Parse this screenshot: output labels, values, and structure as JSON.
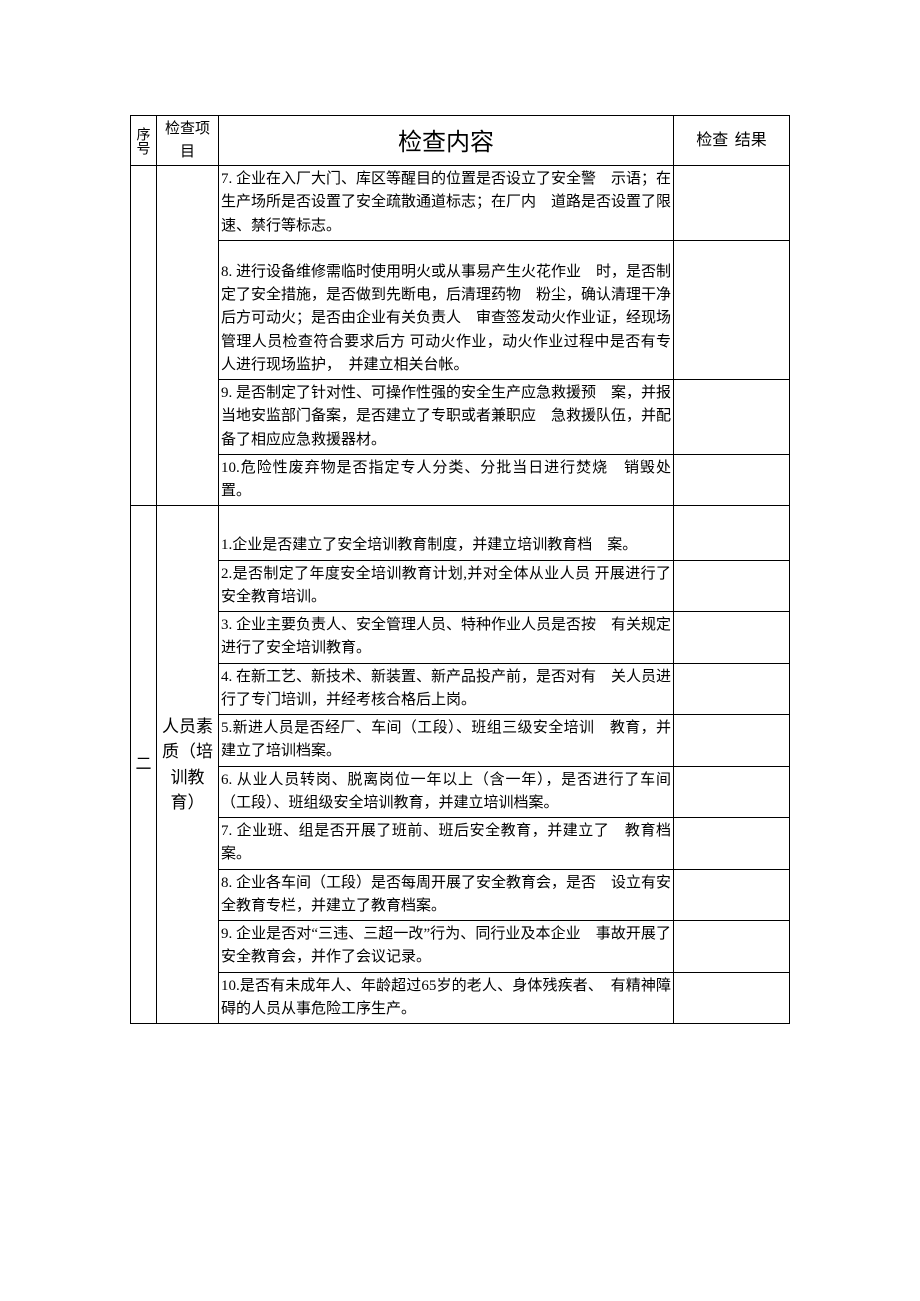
{
  "headers": {
    "seq": "序号",
    "item": "检查项目",
    "content": "检查内容",
    "result": "检查 结果"
  },
  "section1": {
    "rows": [
      "7. 企业在入厂大门、库区等醒目的位置是否设立了安全警　示语；在生产场所是否设置了安全疏散通道标志；在厂内　道路是否设置了限速、禁行等标志。",
      "8. 进行设备维修需临时使用明火或从事易产生火花作业　时，是否制定了安全措施，是否做到先断电，后清理药物　粉尘，确认清理干净后方可动火；是否由企业有关负责人　审查签发动火作业证，经现场管理人员检查符合要求后方 可动火作业，动火作业过程中是否有专人进行现场监护，　并建立相关台帐。",
      "9. 是否制定了针对性、可操作性强的安全生产应急救援预　案，并报当地安监部门备案，是否建立了专职或者兼职应　急救援队伍，并配备了相应应急救援器材。",
      "10.危险性废弃物是否指定专人分类、分批当日进行焚烧　销毁处置。"
    ]
  },
  "section2": {
    "seq": "二",
    "item": "人员素质（培训教育）",
    "rows": [
      "1.企业是否建立了安全培训教育制度，并建立培训教育档　案。",
      "2.是否制定了年度安全培训教育计划,并对全体从业人员 开展进行了安全教育培训。",
      "3. 企业主要负责人、安全管理人员、特种作业人员是否按　有关规定进行了安全培训教育。",
      "4. 在新工艺、新技术、新装置、新产品投产前，是否对有　关人员进行了专门培训，并经考核合格后上岗。",
      "5.新进人员是否经厂、车间（工段）、班组三级安全培训　教育，并建立了培训档案。",
      "6. 从业人员转岗、脱离岗位一年以上（含一年），是否进行了车间（工段）、班组级安全培训教育，并建立培训档案。",
      "7. 企业班、组是否开展了班前、班后安全教育，并建立了　教育档案。",
      "8. 企业各车间（工段）是否每周开展了安全教育会，是否　设立有安全教育专栏，并建立了教育档案。",
      "9. 企业是否对“三违、三超一改”行为、同行业及本企业　事故开展了安全教育会，并作了会议记录。",
      "10.是否有未成年人、年龄超过65岁的老人、身体残疾者、　有精神障碍的人员从事危险工序生产。"
    ]
  }
}
